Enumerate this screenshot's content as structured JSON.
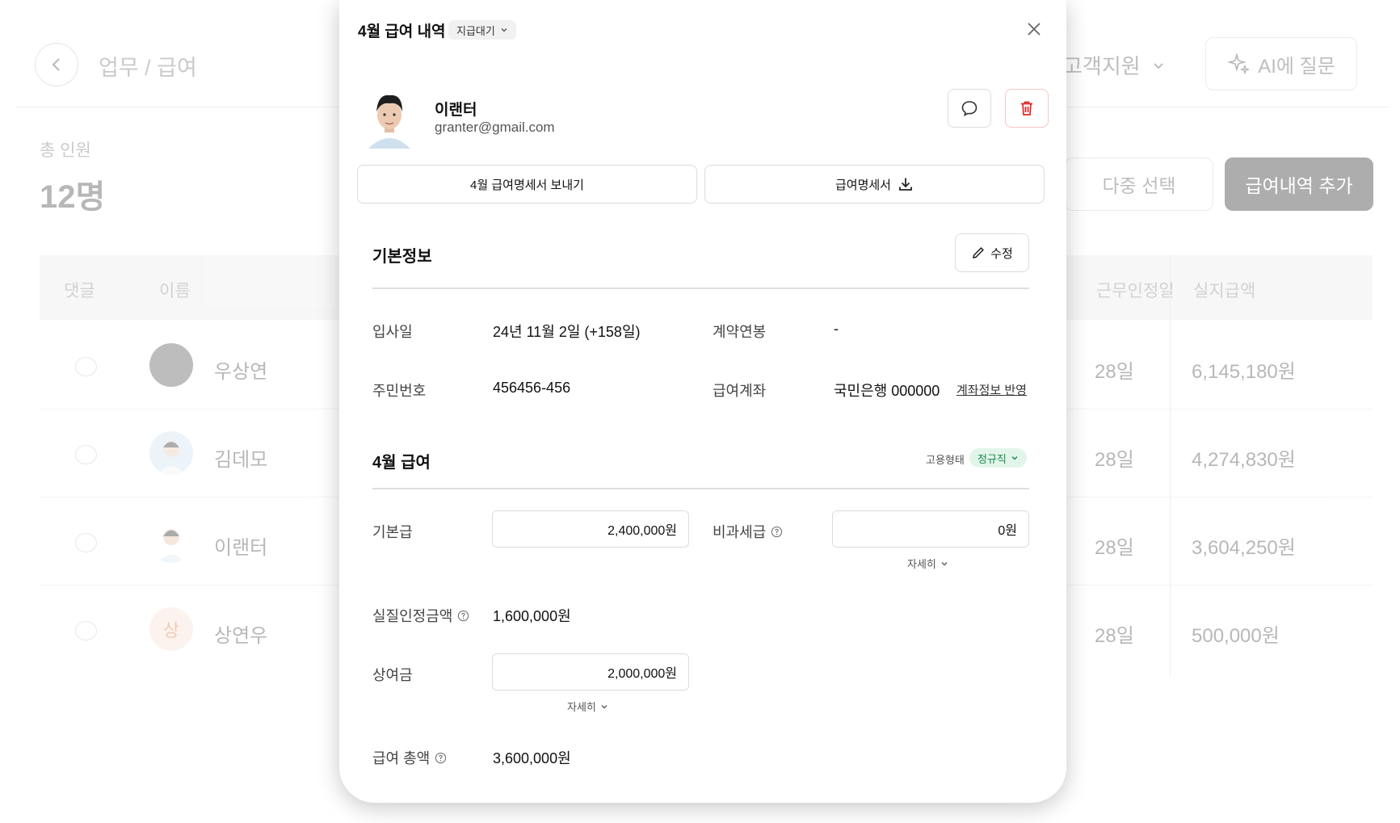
{
  "background": {
    "breadcrumb": "업무 / 급여",
    "support_label": "고객지원",
    "ai_label": "AI에 질문",
    "total_label": "총 인원",
    "total_value": "12명",
    "multi_select_label": "다중 선택",
    "add_payroll_label": "급여내역 추가",
    "columns": {
      "comment": "댓글",
      "name": "이름",
      "work_days": "근무인정일",
      "net_pay": "실지급액"
    },
    "rows": [
      {
        "name": "우상연",
        "days": "28일",
        "pay": "6,145,180원"
      },
      {
        "name": "김데모",
        "days": "28일",
        "pay": "4,274,830원"
      },
      {
        "name": "이랜터",
        "days": "28일",
        "pay": "3,604,250원"
      },
      {
        "name": "상연우",
        "days": "28일",
        "pay": "500,000원",
        "initial": "상"
      }
    ]
  },
  "modal": {
    "title": "4월 급여 내역",
    "status": "지급대기",
    "employee": {
      "name": "이랜터",
      "email": "granter@gmail.com"
    },
    "send_payslip_label": "4월 급여명세서 보내기",
    "download_payslip_label": "급여명세서",
    "basic_info": {
      "title": "기본정보",
      "edit_label": "수정",
      "hire_date_label": "입사일",
      "hire_date_value": "24년 11월 2일 (+158일)",
      "contract_label": "계약연봉",
      "contract_value": "-",
      "resident_label": "주민번호",
      "resident_value": "456456-456",
      "account_label": "급여계좌",
      "account_value": "국민은행 000000",
      "account_link": "계좌정보 반영"
    },
    "salary": {
      "title": "4월 급여",
      "employment_label": "고용형태",
      "employment_value": "정규직",
      "base_label": "기본급",
      "base_value": "2,400,000원",
      "nontax_label": "비과세급",
      "nontax_value": "0원",
      "detail_label": "자세히",
      "actual_label": "실질인정금액",
      "actual_value": "1,600,000원",
      "bonus_label": "상여금",
      "bonus_value": "2,000,000원",
      "total_label": "급여 총액",
      "total_value": "3,600,000원"
    }
  }
}
